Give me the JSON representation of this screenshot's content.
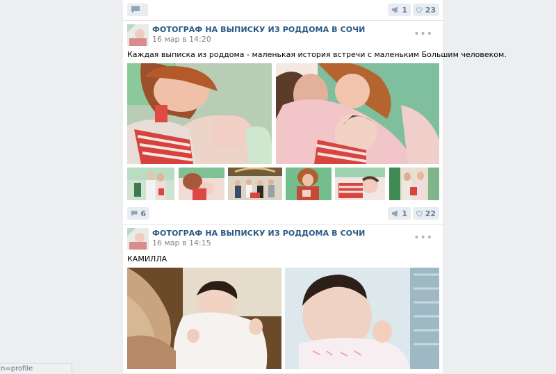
{
  "top_bar": {
    "comment_count": "",
    "share_count": "1",
    "like_count": "23"
  },
  "posts": [
    {
      "author": "ФОТОГРАФ НА ВЫПИСКУ ИЗ РОДДОМА В СОЧИ",
      "date": "16 мар в 14:20",
      "text": "Каждая выписка из роддома - маленькая история встречи с маленьким Большим человеком.",
      "photo_count": 8,
      "comments": "6",
      "shares": "1",
      "likes": "22"
    },
    {
      "author": "ФОТОГРАФ НА ВЫПИСКУ ИЗ РОДДОМА В СОЧИ",
      "date": "16 мар в 14:15",
      "text": "КАМИЛЛА",
      "photo_count": 2
    }
  ],
  "more_icon": "•••",
  "icons": {
    "comment": "comment-icon",
    "share": "megaphone-icon",
    "like": "heart-icon",
    "more": "more-dots-icon"
  },
  "colors": {
    "link": "#2a5885",
    "meta": "#828282",
    "action_bg": "#e9edf1",
    "action_text": "#5e7a9a",
    "page_bg": "#edeef0"
  },
  "status_bar": "n=profile"
}
